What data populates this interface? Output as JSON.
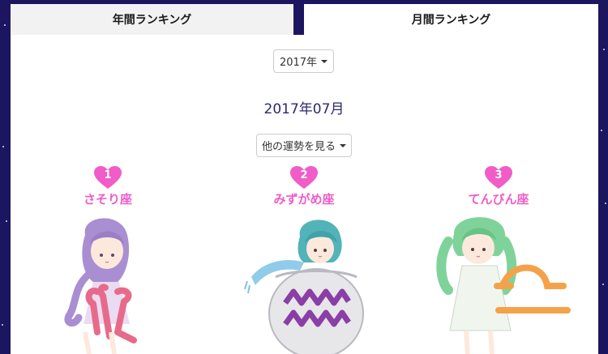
{
  "tabs": {
    "annual_label": "年間ランキング",
    "monthly_label": "月間ランキング",
    "active": "monthly"
  },
  "year_select": {
    "label": "2017年"
  },
  "month_title": "2017年07月",
  "fortune_select": {
    "label": "他の運勢を見る"
  },
  "ranking": [
    {
      "rank": "1",
      "sign": "さそり座"
    },
    {
      "rank": "2",
      "sign": "みずがめ座"
    },
    {
      "rank": "3",
      "sign": "てんびん座"
    }
  ],
  "colors": {
    "background": "#1c1660",
    "accent_pink": "#f05cc8",
    "title_navy": "#2a2a6e"
  }
}
